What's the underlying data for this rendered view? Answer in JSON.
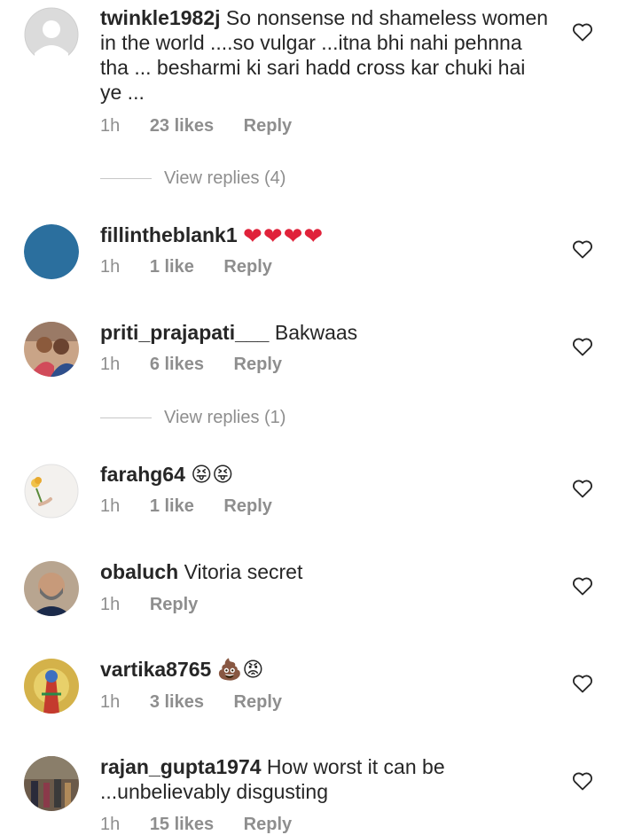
{
  "comments": [
    {
      "username": "twinkle1982j",
      "text": "So nonsense nd shameless women in the world ....so vulgar ...itna bhi nahi pehnna tha ... besharmi ki sari hadd cross kar chuki hai ye ...",
      "time": "1h",
      "likes": "23 likes",
      "reply": "Reply",
      "view_replies": "View replies (4)"
    },
    {
      "username": "fillintheblank1",
      "text": "❤❤❤❤",
      "time": "1h",
      "likes": "1 like",
      "reply": "Reply"
    },
    {
      "username": "priti_prajapati___",
      "text": "Bakwaas",
      "time": "1h",
      "likes": "6 likes",
      "reply": "Reply",
      "view_replies": "View replies (1)"
    },
    {
      "username": "farahg64",
      "text": "😝😝",
      "time": "1h",
      "likes": "1 like",
      "reply": "Reply"
    },
    {
      "username": "obaluch",
      "text": "Vitoria secret",
      "time": "1h",
      "reply": "Reply"
    },
    {
      "username": "vartika8765",
      "text": "💩😡",
      "time": "1h",
      "likes": "3 likes",
      "reply": "Reply"
    },
    {
      "username": "rajan_gupta1974",
      "text": "How worst it can be ...unbelievably disgusting",
      "time": "1h",
      "likes": "15 likes",
      "reply": "Reply"
    }
  ],
  "colors": {
    "text": "#262626",
    "meta": "#8e8e8e",
    "heart_emoji": "#e0223a",
    "avatar_blue": "#2b6f9e"
  },
  "icons": {
    "like": "heart-outline-icon"
  }
}
